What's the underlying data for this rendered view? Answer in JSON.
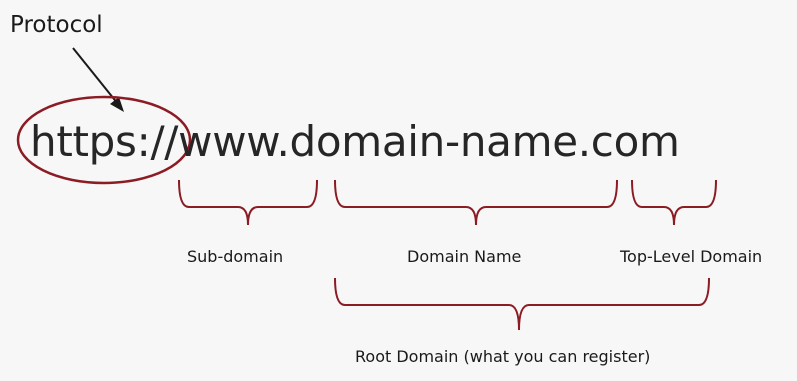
{
  "labels": {
    "protocol": "Protocol",
    "url": "https://www.domain-name.com",
    "subdomain": "Sub-domain",
    "domain_name": "Domain Name",
    "tld": "Top-Level Domain",
    "root_domain": "Root Domain (what you can register)"
  },
  "colors": {
    "bracket": "#8b1c24",
    "text": "#1a1a1a",
    "background": "#f7f7f7"
  }
}
